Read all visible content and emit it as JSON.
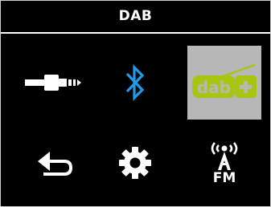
{
  "header": {
    "title": "DAB"
  },
  "menu": {
    "items": [
      {
        "name": "aux-input",
        "icon": "audio-jack-icon"
      },
      {
        "name": "bluetooth",
        "icon": "bluetooth-icon"
      },
      {
        "name": "dab-plus",
        "icon": "dab-plus-radio-icon",
        "selected": true
      },
      {
        "name": "back",
        "icon": "back-arrow-icon"
      },
      {
        "name": "settings",
        "icon": "gear-icon"
      },
      {
        "name": "fm-radio",
        "icon": "fm-antenna-icon",
        "label": "FM"
      }
    ]
  },
  "colors": {
    "background": "#000000",
    "text": "#ffffff",
    "bluetooth": "#1e9be9",
    "dab": "#a8c512",
    "selected_tile": "#b7b7b7"
  }
}
